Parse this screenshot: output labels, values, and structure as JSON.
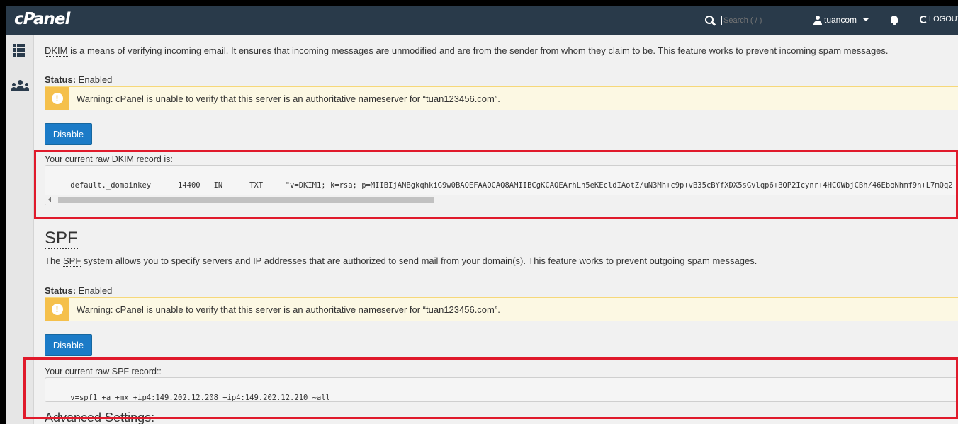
{
  "header": {
    "logo": "cPanel",
    "search_placeholder": "Search ( / )",
    "username": "tuancom",
    "logout": "LOGOUT"
  },
  "dkim": {
    "abbr": "DKIM",
    "description": " is a means of verifying incoming email. It ensures that incoming messages are unmodified and are from the sender from whom they claim to be. This feature works to prevent incoming spam messages.",
    "status_label": "Status:",
    "status_value": " Enabled",
    "warning": "Warning: cPanel is unable to verify that this server is an authoritative nameserver for “tuan123456.com”.",
    "button": "Disable",
    "raw_label": "Your current raw DKIM record is:",
    "raw_record": "default._domainkey      14400   IN      TXT     \"v=DKIM1; k=rsa; p=MIIBIjANBgkqhkiG9w0BAQEFAAOCAQ8AMIIBCgKCAQEArhLn5eKEcldIAotZ/uN3Mh+c9p+vB35cBYfXDX5sGvlqp6+BQP2Icynr+4HCOWbjCBh/46EboNhmf9n+L7mQq2"
  },
  "spf": {
    "heading": "SPF",
    "intro_prefix": "The ",
    "abbr": "SPF",
    "description": " system allows you to specify servers and IP addresses that are authorized to send mail from your domain(s). This feature works to prevent outgoing spam messages.",
    "status_label": "Status:",
    "status_value": " Enabled",
    "warning": "Warning: cPanel is unable to verify that this server is an authoritative nameserver for “tuan123456.com”.",
    "button": "Disable",
    "raw_label_prefix": "Your current raw ",
    "raw_label_abbr": "SPF",
    "raw_label_suffix": " record::",
    "raw_record": "v=spf1 +a +mx +ip4:149.202.12.208 +ip4:149.202.12.210 ~all",
    "advanced": "Advanced Settings:"
  }
}
